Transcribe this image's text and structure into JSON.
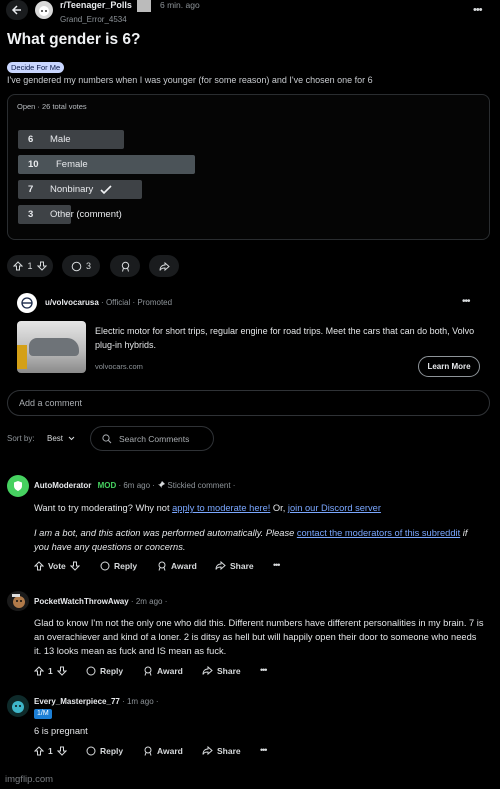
{
  "header": {
    "subreddit": "r/Teenager_Polls",
    "time": "6 min. ago",
    "username": "Grand_Error_4534"
  },
  "post": {
    "title": "What gender is 6?",
    "flair": "Decide For Me",
    "body": "I've gendered my numbers when I was younger (for some reason) and I've chosen one for 6",
    "poll": {
      "status": "Open · 26 total votes",
      "options": [
        {
          "votes": "6",
          "label": "Male",
          "fraction": 0.6
        },
        {
          "votes": "10",
          "label": "Female",
          "fraction": 1.0
        },
        {
          "votes": "7",
          "label": "Nonbinary",
          "fraction": 0.7,
          "selected": true
        },
        {
          "votes": "3",
          "label": "Other (comment)",
          "fraction": 0.3
        }
      ]
    },
    "actions": {
      "score": "1",
      "comments": "3"
    }
  },
  "ad": {
    "advertiser": "u/volvocarusa",
    "official": "Official",
    "promoted": "Promoted",
    "text": "Electric motor for short trips, regular engine for road trips. Meet the cars that can do both, Volvo plug-in hybrids.",
    "domain": "volvocars.com",
    "cta": "Learn More"
  },
  "add_comment": {
    "placeholder": "Add a comment"
  },
  "sort": {
    "label": "Sort by:",
    "value": "Best",
    "search_placeholder": "Search Comments"
  },
  "comments": [
    {
      "author": "AutoModerator",
      "mod": "MOD",
      "time": "6m ago",
      "stickied": "Stickied comment",
      "line1_a": "Want to try moderating? Why not ",
      "line1_link1": "apply to moderate here!",
      "line1_b": " Or, ",
      "line1_link2": "join our Discord server",
      "line2_a": "I am a bot, and this action was performed automatically. Please ",
      "line2_link": "contact the moderators of this subreddit",
      "line2_b": " if you have any questions or concerns.",
      "vote": "Vote",
      "reply": "Reply",
      "award": "Award",
      "share": "Share"
    },
    {
      "author": "PocketWatchThrowAway",
      "time": "2m ago",
      "body": "Glad to know I'm not the only one who did this. Different numbers have different personalities in my brain. 7 is an overachiever and kind of a loner. 2 is ditsy as hell but will happily open their door to someone who needs it. 13 looks mean as fuck and IS mean as fuck.",
      "score": "1",
      "reply": "Reply",
      "award": "Award",
      "share": "Share"
    },
    {
      "author": "Every_Masterpiece_77",
      "time": "1m ago",
      "flair": "1/M",
      "body": "6 is pregnant",
      "score": "1",
      "reply": "Reply",
      "award": "Award",
      "share": "Share"
    }
  ],
  "watermark": "imgflip.com",
  "colors": {
    "background": "#000000",
    "accent_link": "#7aa7ff",
    "mod_green": "#46d160",
    "flair_blue": "#c9d6ff"
  }
}
